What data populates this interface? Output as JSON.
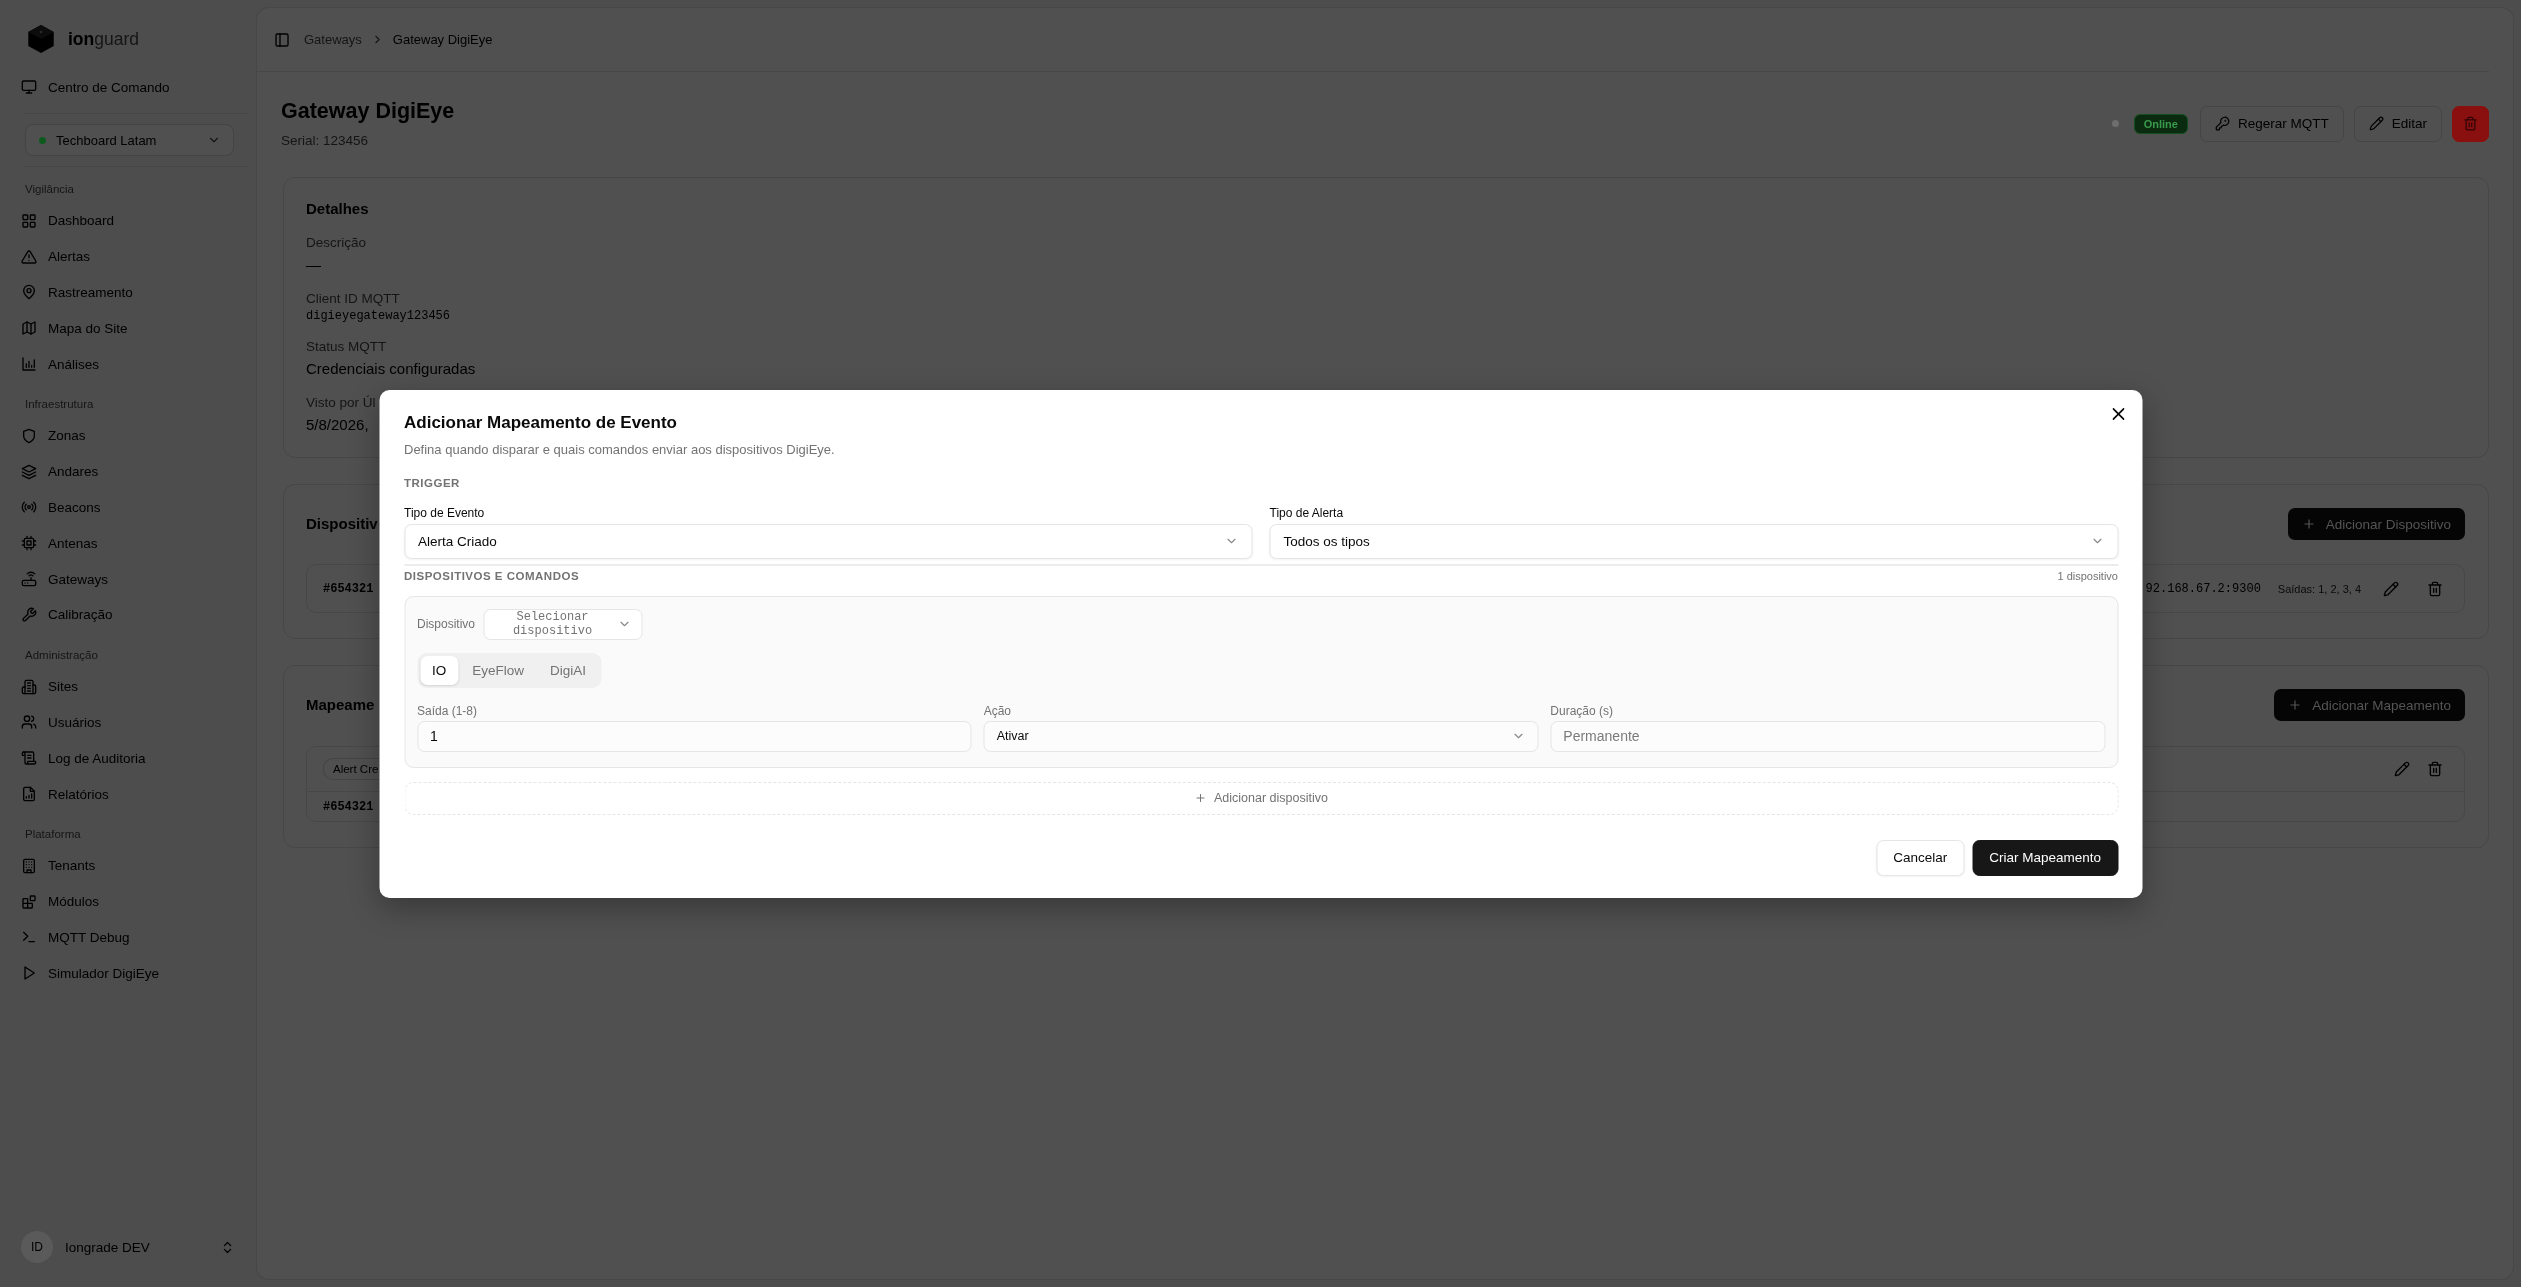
{
  "sidebar": {
    "logo": "**ion**guard",
    "command_center": {
      "label": "Centro de Comando",
      "selected": false
    },
    "tenant": "Techboard Latam",
    "sections": [
      {
        "title": "Vigilância",
        "items": [
          {
            "label": "Dashboard",
            "selected": false
          },
          {
            "label": "Alertas",
            "selected": false
          },
          {
            "label": "Rastreamento",
            "selected": false
          },
          {
            "label": "Mapa do Site",
            "selected": false
          },
          {
            "label": "Análises",
            "selected": false
          }
        ]
      },
      {
        "title": "Infraestrutura",
        "items": [
          {
            "label": "Zonas",
            "selected": false
          },
          {
            "label": "Andares",
            "selected": false
          },
          {
            "label": "Beacons",
            "selected": false
          },
          {
            "label": "Antenas",
            "selected": false
          },
          {
            "label": "Gateways",
            "selected": false
          },
          {
            "label": "Calibração",
            "selected": false
          }
        ]
      },
      {
        "title": "Administração",
        "items": [
          {
            "label": "Sites",
            "selected": false
          },
          {
            "label": "Usuários",
            "selected": false
          },
          {
            "label": "Log de Auditoria",
            "selected": false
          },
          {
            "label": "Relatórios",
            "selected": false
          }
        ]
      },
      {
        "title": "Plataforma",
        "items": [
          {
            "label": "Tenants",
            "selected": false
          },
          {
            "label": "Módulos",
            "selected": false
          },
          {
            "label": "MQTT Debug",
            "selected": false
          },
          {
            "label": "Simulador DigiEye",
            "selected": false
          }
        ]
      }
    ],
    "user": {
      "initials": "ID",
      "name": "Iongrade DEV"
    }
  },
  "breadcrumb": [
    {
      "label": "Gateways"
    },
    {
      "label": "Gateway DigiEye"
    }
  ],
  "header": {
    "title": "Gateway DigiEye",
    "serial": "Serial: 123456",
    "status": "Online",
    "actions": [
      {
        "kind": "regenerate",
        "label": "Regerar MQTT"
      },
      {
        "kind": "edit",
        "label": "Editar"
      },
      {
        "kind": "delete"
      }
    ]
  },
  "details": {
    "title": "Detalhes",
    "fields": [
      {
        "label": "Descrição",
        "value": "—",
        "kind": "text"
      },
      {
        "label": "Client ID MQTT",
        "value": "digieyegateway123456",
        "kind": "mono"
      },
      {
        "label": "Status MQTT",
        "value": "Credenciais configuradas",
        "kind": "text"
      },
      {
        "label": "Visto por Úl",
        "value": "5/8/2026,",
        "kind": "text"
      }
    ]
  },
  "devices_card": {
    "title": "Dispositiv",
    "add_button": "Adicionar Dispositivo",
    "rows": [
      {
        "serial": "#654321",
        "address": "92.168.67.2:9300",
        "outputs": "Saídas: 1, 2, 3, 4"
      }
    ]
  },
  "mappings_card": {
    "title": "Mapeame",
    "add_button": "Adicionar Mapeamento",
    "items": [
      {
        "event": "Alert Cre",
        "device": "#654321"
      }
    ]
  },
  "dialog": {
    "title": "Adicionar Mapeamento de Evento",
    "description": "Defina quando disparar e quais comandos enviar aos dispositivos DigiEye.",
    "trigger": {
      "heading": "TRIGGER",
      "fields": [
        {
          "label": "Tipo de Evento",
          "value": "Alerta Criado"
        },
        {
          "label": "Tipo de Alerta",
          "value": "Todos os tipos"
        }
      ]
    },
    "devices": {
      "heading": "DISPOSITIVOS E COMANDOS",
      "count": "1 dispositivo",
      "items": [
        {
          "device_label": "Dispositivo",
          "device_placeholder": "Selecionar dispositivo",
          "tabs": [
            {
              "label": "IO",
              "selected": true
            },
            {
              "label": "EyeFlow",
              "selected": false
            },
            {
              "label": "DigiAI",
              "selected": false
            }
          ],
          "fields": [
            {
              "kind": "input",
              "label": "Saída (1-8)",
              "value": "1"
            },
            {
              "kind": "select",
              "label": "Ação",
              "value": "Ativar"
            },
            {
              "kind": "input",
              "label": "Duração (s)",
              "placeholder": "Permanente"
            }
          ]
        }
      ],
      "add_device": "Adicionar dispositivo"
    },
    "buttons": [
      {
        "kind": "secondary",
        "label": "Cancelar"
      },
      {
        "kind": "primary",
        "label": "Criar Mapeamento"
      }
    ]
  }
}
